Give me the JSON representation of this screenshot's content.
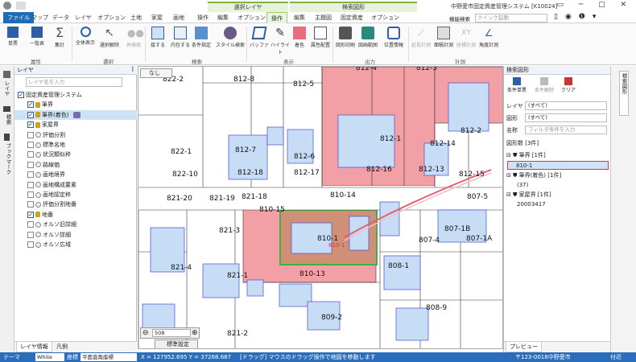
{
  "app": {
    "title": "中野愛市固定資産管理システム [K10024]",
    "context_tab_1": "選択レイヤ",
    "context_tab_2": "検索図形",
    "function_search_label": "機能検索",
    "function_search_placeholder": "クイック起動"
  },
  "menu": [
    "ファイル",
    "マップ",
    "データ",
    "レイヤ",
    "オプション",
    "土地",
    "家屋",
    "画地",
    "操作",
    "編集",
    "オプション",
    "操作",
    "編集",
    "主題図",
    "固定資産",
    "オプション"
  ],
  "ribbon": {
    "groups": [
      {
        "name": "属性",
        "buttons": [
          "単票",
          "一覧表",
          "集計"
        ]
      },
      {
        "name": "選択",
        "buttons": [
          "全体表示",
          "選択解除",
          "再検索"
        ]
      },
      {
        "name": "検索",
        "buttons": [
          "接する",
          "内包する",
          "条件指定",
          "スタイル検索"
        ]
      },
      {
        "name": "表示",
        "buttons": [
          "バッファ",
          "ハイライト",
          "着色",
          "属性配置"
        ]
      },
      {
        "name": "出力",
        "buttons": [
          "図形印刷",
          "図画範囲",
          "位置情報"
        ]
      },
      {
        "name": "計測",
        "buttons": [
          "延長計測",
          "面積計測",
          "座標計測",
          "角度計測"
        ]
      }
    ]
  },
  "left_strip": [
    "レイヤ",
    "検索",
    "ブックマーク"
  ],
  "layer_panel": {
    "title": "レイヤ",
    "filter_placeholder": "レイヤ名を入力",
    "tree": [
      {
        "label": "固定資産管理システム",
        "checked": true,
        "level": 0
      },
      {
        "label": "筆界",
        "checked": true,
        "level": 1
      },
      {
        "label": "筆界(着色)",
        "checked": true,
        "level": 1,
        "selected": true
      },
      {
        "label": "家屋界",
        "checked": true,
        "level": 1
      },
      {
        "label": "評価分割",
        "checked": false,
        "level": 1
      },
      {
        "label": "標準名地",
        "checked": false,
        "level": 1
      },
      {
        "label": "状況類似枠",
        "checked": false,
        "level": 1
      },
      {
        "label": "路線価",
        "checked": false,
        "level": 1
      },
      {
        "label": "画地境界",
        "checked": false,
        "level": 1
      },
      {
        "label": "画地構成要素",
        "checked": false,
        "level": 1
      },
      {
        "label": "画地認定枠",
        "checked": false,
        "level": 1
      },
      {
        "label": "評価分割地番",
        "checked": false,
        "level": 1
      },
      {
        "label": "地番",
        "checked": true,
        "level": 1
      },
      {
        "label": "オルソ旧詳細",
        "checked": false,
        "level": 1
      },
      {
        "label": "オルソ詳細",
        "checked": false,
        "level": 1
      },
      {
        "label": "オルソ広域",
        "checked": false,
        "level": 1
      }
    ],
    "bottom_tabs": [
      "レイヤ情報",
      "凡例"
    ]
  },
  "map": {
    "overlay_label": "なし",
    "scale": "508",
    "settings_label": "標準設定",
    "parcels": [
      "822-2",
      "812-8",
      "812-5",
      "812-4",
      "812-3",
      "812-1",
      "812-14",
      "812-2",
      "822-1",
      "812-7",
      "812-6",
      "822-10",
      "812-18",
      "812-17",
      "812-16",
      "812-13",
      "812-15",
      "821-20",
      "821-19",
      "821-18",
      "810-14",
      "807-5",
      "810-15",
      "807-1B",
      "821-3",
      "810-1",
      "807-1A",
      "807-4",
      "821-4",
      "808-1",
      "821-1",
      "810-13",
      "808-9",
      "809-2",
      "821-2"
    ],
    "selected_label": "810-1"
  },
  "right_panel": {
    "title": "検索図形",
    "buttons": [
      "条件単票",
      "条件解除",
      "クリア"
    ],
    "layer_label": "レイヤ",
    "layer_value": "(すべて)",
    "shape_label": "図形",
    "shape_value": "(すべて)",
    "name_label": "名称",
    "name_placeholder": "フィルタ条件を入力",
    "count_label": "図形数 [3件]",
    "groups": [
      {
        "name": "筆界 [1件]",
        "items": [
          "810-1"
        ]
      },
      {
        "name": "筆界(着色) [1件]",
        "items": [
          "(37)"
        ]
      },
      {
        "name": "家屋界 [1件]",
        "items": [
          "20003417"
        ]
      }
    ],
    "preview_tab": "プレビュー"
  },
  "right_strip": [
    "検索図形"
  ],
  "status": {
    "theme_label": "テーマ",
    "theme_value": "White",
    "coord_label": "座標",
    "coord_system": "平面直角座標",
    "coords": "X = 127952.695 Y = 37268.687",
    "hint": "[ドラッグ] マウスのドラッグ操作で地図を移動します",
    "address": "〒123-0018中野愛市",
    "trailing": "付近"
  }
}
